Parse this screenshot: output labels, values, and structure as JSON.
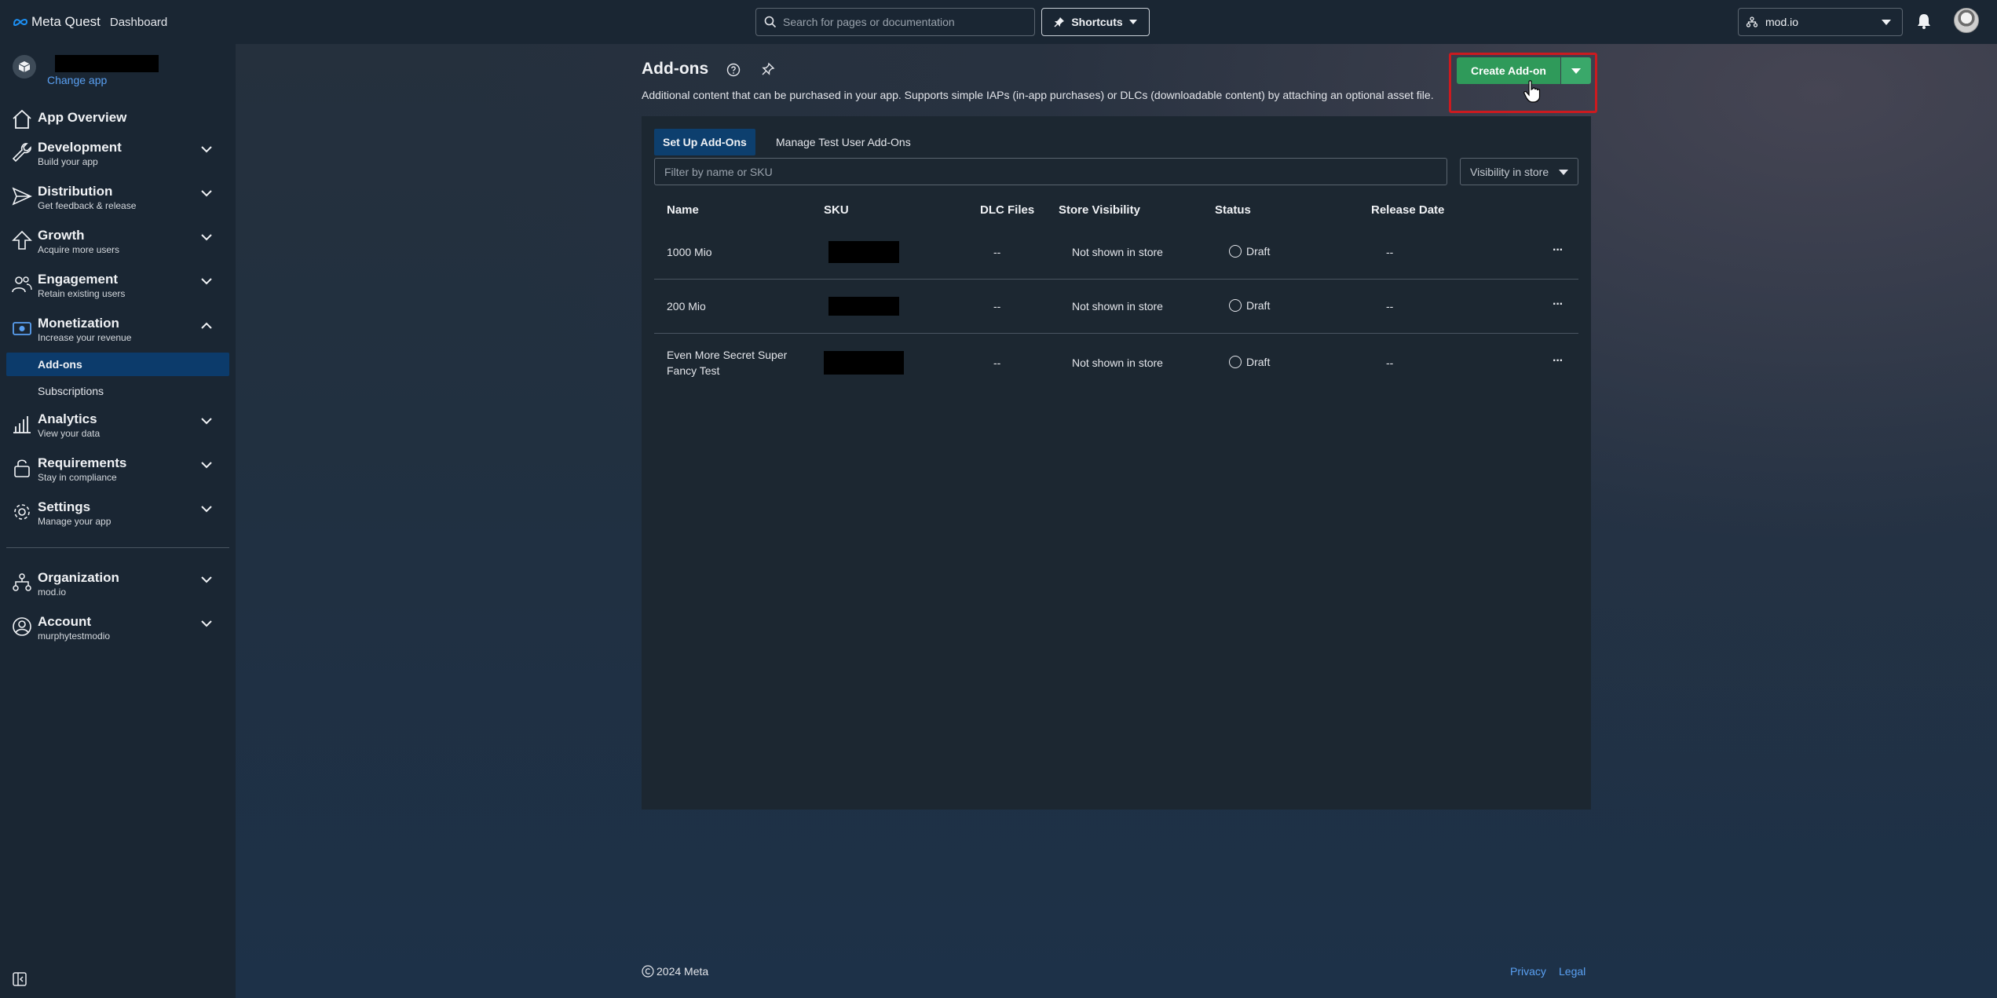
{
  "header": {
    "brand": "Meta Quest",
    "section": "Dashboard",
    "search_placeholder": "Search for pages or documentation",
    "shortcuts_label": "Shortcuts",
    "org_selector": "mod.io"
  },
  "sidebar": {
    "change_app": "Change app",
    "items": [
      {
        "title": "App Overview",
        "subtitle": "",
        "icon": "home-icon"
      },
      {
        "title": "Development",
        "subtitle": "Build your app",
        "icon": "wrench-icon"
      },
      {
        "title": "Distribution",
        "subtitle": "Get feedback & release",
        "icon": "send-icon"
      },
      {
        "title": "Growth",
        "subtitle": "Acquire more users",
        "icon": "arrow-up-icon"
      },
      {
        "title": "Engagement",
        "subtitle": "Retain existing users",
        "icon": "users-icon"
      },
      {
        "title": "Monetization",
        "subtitle": "Increase your revenue",
        "icon": "money-icon"
      },
      {
        "title": "Analytics",
        "subtitle": "View your data",
        "icon": "bar-chart-icon"
      },
      {
        "title": "Requirements",
        "subtitle": "Stay in compliance",
        "icon": "lock-icon"
      },
      {
        "title": "Settings",
        "subtitle": "Manage your app",
        "icon": "gear-icon"
      },
      {
        "title": "Organization",
        "subtitle": "mod.io",
        "icon": "org-chart-icon"
      },
      {
        "title": "Account",
        "subtitle": "murphytestmodio",
        "icon": "account-icon"
      }
    ],
    "monetization_sub": [
      "Add-ons",
      "Subscriptions"
    ]
  },
  "page": {
    "title": "Add-ons",
    "description": "Additional content that can be purchased in your app. Supports simple IAPs (in-app purchases) or DLCs (downloadable content) by attaching an optional asset file.",
    "create_button": "Create Add-on",
    "tabs": [
      "Set Up Add-Ons",
      "Manage Test User Add-Ons"
    ],
    "filter_placeholder": "Filter by name or SKU",
    "visibility_filter": "Visibility in store",
    "columns": [
      "Name",
      "SKU",
      "DLC Files",
      "Store Visibility",
      "Status",
      "Release Date"
    ],
    "rows": [
      {
        "name": "1000 Mio",
        "dlc": "--",
        "visibility": "Not shown in store",
        "status": "Draft",
        "release": "--"
      },
      {
        "name": "200 Mio",
        "dlc": "--",
        "visibility": "Not shown in store",
        "status": "Draft",
        "release": "--"
      },
      {
        "name": "Even More Secret Super Fancy Test",
        "dlc": "--",
        "visibility": "Not shown in store",
        "status": "Draft",
        "release": "--"
      }
    ],
    "more_glyph": "···"
  },
  "footer": {
    "copyright": "2024 Meta",
    "links": [
      "Privacy",
      "Legal"
    ]
  },
  "colors": {
    "accent_green": "#2f9a5a",
    "highlight_red": "#cc1a1f",
    "active_blue": "#0c3b6b",
    "link_blue": "#5aa0f2"
  }
}
